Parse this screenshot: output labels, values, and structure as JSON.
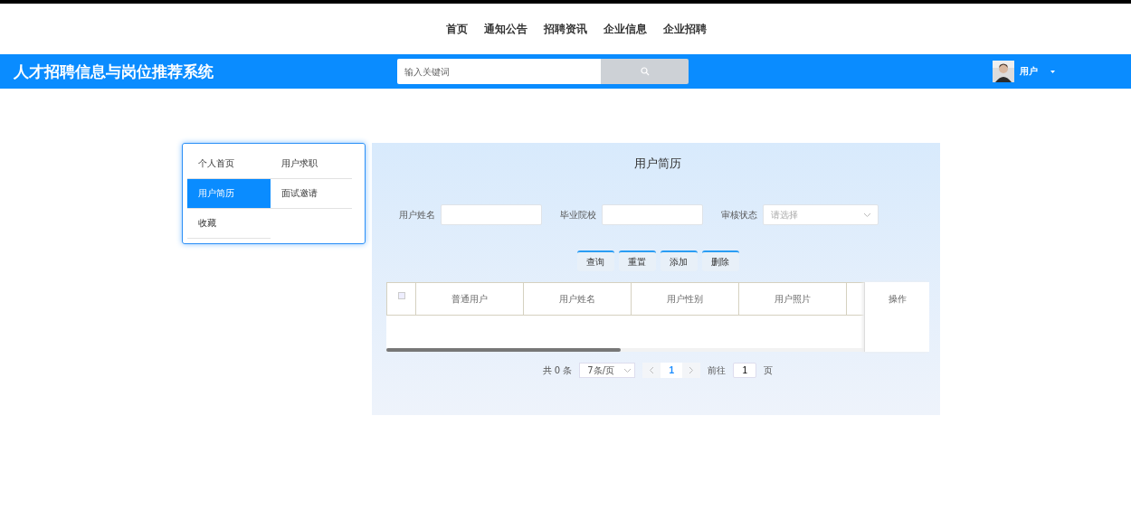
{
  "nav": [
    {
      "label": "首页"
    },
    {
      "label": "通知公告"
    },
    {
      "label": "招聘资讯"
    },
    {
      "label": "企业信息"
    },
    {
      "label": "企业招聘"
    }
  ],
  "header": {
    "title": "人才招聘信息与岗位推荐系统",
    "search": {
      "placeholder": "输入关键词"
    },
    "user": {
      "name": "用户"
    }
  },
  "sidebar": {
    "items": [
      {
        "label": "个人首页",
        "selected": false
      },
      {
        "label": "用户求职",
        "selected": false
      },
      {
        "label": "用户简历",
        "selected": true
      },
      {
        "label": "面试邀请",
        "selected": false
      },
      {
        "label": "收藏",
        "selected": false
      }
    ]
  },
  "panel": {
    "title": "用户简历",
    "filters": [
      {
        "kind": "input",
        "label": "用户姓名"
      },
      {
        "kind": "input",
        "label": "毕业院校"
      },
      {
        "kind": "select",
        "label": "审核状态",
        "placeholder": "请选择"
      }
    ],
    "buttons": [
      {
        "label": "查询"
      },
      {
        "label": "重置"
      },
      {
        "label": "添加"
      },
      {
        "label": "删除"
      }
    ],
    "table": {
      "columns": [
        "普通用户",
        "用户姓名",
        "用户性别",
        "用户照片"
      ],
      "action_column": "操作",
      "select_all": {
        "checked": false
      }
    },
    "pagination": {
      "total": "共 0 条",
      "page_size": "7条/页",
      "pages": [
        {
          "label": "1",
          "selected": true
        }
      ],
      "goto_label": "前往",
      "goto_value": "1",
      "goto_suffix": "页"
    }
  }
}
